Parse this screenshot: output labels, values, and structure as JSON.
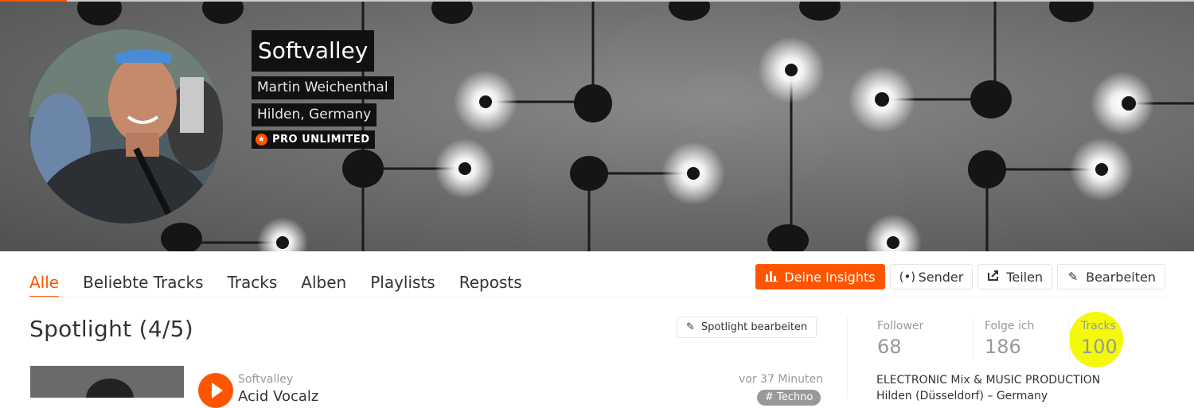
{
  "profile": {
    "display_name": "Softvalley",
    "real_name": "Martin Weichenthal",
    "location": "Hilden, Germany",
    "badge": "PRO UNLIMITED"
  },
  "tabs": [
    {
      "label": "Alle",
      "active": true
    },
    {
      "label": "Beliebte Tracks"
    },
    {
      "label": "Tracks"
    },
    {
      "label": "Alben"
    },
    {
      "label": "Playlists"
    },
    {
      "label": "Reposts"
    }
  ],
  "actions": {
    "insights": "Deine Insights",
    "station": "Sender",
    "share": "Teilen",
    "edit": "Bearbeiten"
  },
  "spotlight": {
    "title": "Spotlight (4/5)",
    "edit_label": "Spotlight bearbeiten",
    "track": {
      "user": "Softvalley",
      "title": "Acid Vocalz",
      "time": "vor 37 Minuten",
      "tag": "# Techno"
    }
  },
  "stats": {
    "followers_label": "Follower",
    "followers_value": "68",
    "following_label": "Folge ich",
    "following_value": "186",
    "tracks_label": "Tracks",
    "tracks_value": "100"
  },
  "bio": {
    "line1": "ELECTRONIC Mix & MUSIC PRODUCTION",
    "line2": "Hilden (Düsseldorf) – Germany"
  },
  "colors": {
    "accent": "#ff5500",
    "highlight": "#f4f90a"
  }
}
